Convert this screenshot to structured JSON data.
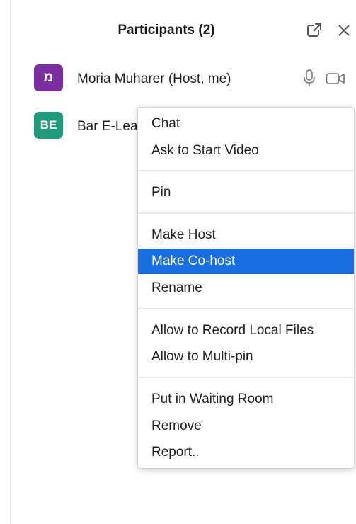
{
  "header": {
    "title": "Participants (2)",
    "popout_icon": "popout-icon",
    "close_icon": "close-icon"
  },
  "participants": [
    {
      "initials": "מ",
      "name": "Moria Muharer (Host, me)",
      "avatar_color": "#7b2ea0",
      "icons": [
        "microphone-icon",
        "video-camera-icon"
      ]
    },
    {
      "initials": "BE",
      "name": "Bar E-Lea",
      "avatar_color": "#1f9a7c"
    }
  ],
  "context_menu": {
    "items": [
      {
        "label": "Chat"
      },
      {
        "label": "Ask to Start Video"
      },
      {
        "label": "Pin"
      },
      {
        "label": "Make Host"
      },
      {
        "label": "Make Co-host",
        "highlighted": true
      },
      {
        "label": "Rename"
      },
      {
        "label": "Allow to Record Local Files"
      },
      {
        "label": "Allow to Multi-pin"
      },
      {
        "label": "Put in Waiting Room"
      },
      {
        "label": "Remove"
      },
      {
        "label": "Report.."
      }
    ],
    "highlight_color": "#1a6fe0"
  }
}
